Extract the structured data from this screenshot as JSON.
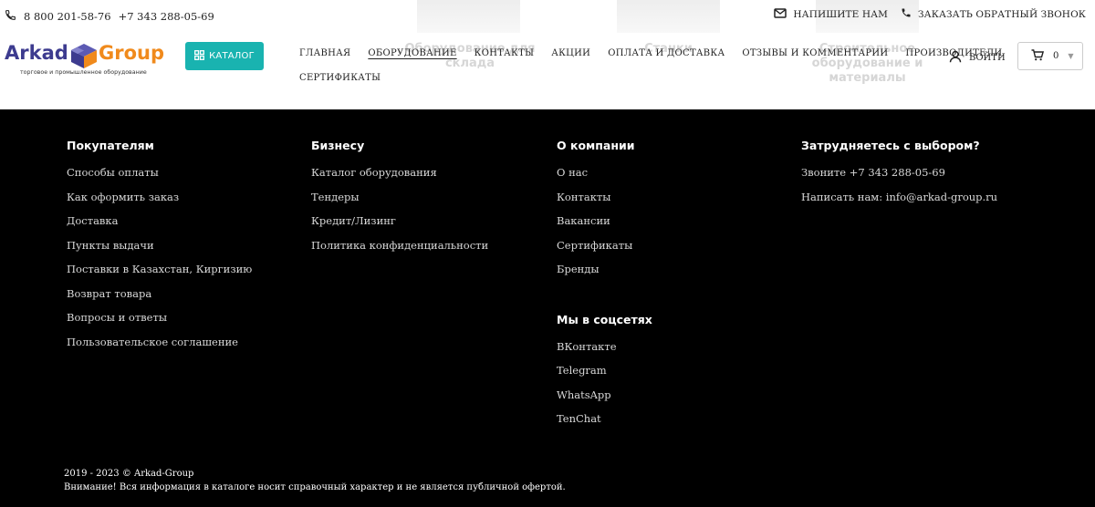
{
  "header": {
    "phones": [
      "8 800 201-58-76",
      "+7 343 288-05-69"
    ],
    "write_us": "НАПИШИТЕ НАМ",
    "callback": "ЗАКАЗАТЬ ОБРАТНЫЙ ЗВОНОК",
    "logo": {
      "word1": "Arkad",
      "word2": "Group",
      "tagline": "торговое и промышленное оборудование"
    },
    "catalog_button": "КАТАЛОГ",
    "nav": [
      {
        "label": "ГЛАВНАЯ"
      },
      {
        "label": "ОБОРУДОВАНИЕ"
      },
      {
        "label": "КОНТАКТЫ"
      },
      {
        "label": "АКЦИИ"
      },
      {
        "label": "ОПЛАТА И ДОСТАВКА"
      },
      {
        "label": "ОТЗЫВЫ И КОММЕНТАРИИ"
      },
      {
        "label": "ПРОИЗВОДИТЕЛИ"
      },
      {
        "label": "СЕРТИФИКАТЫ"
      }
    ],
    "active_nav": "ОБОРУДОВАНИЕ",
    "login": "ВОЙТИ",
    "cart_count": "0",
    "background_captions": [
      "Оборудование для склада",
      "Станки",
      "Строительное оборудование и материалы"
    ]
  },
  "footer": {
    "columns": [
      {
        "title": "Покупателям",
        "links": [
          "Способы оплаты",
          "Как оформить заказ",
          "Доставка",
          "Пункты выдачи",
          "Поставки в Казахстан, Киргизию",
          "Возврат товара",
          "Вопросы и ответы",
          "Пользовательское соглашение"
        ]
      },
      {
        "title": "Бизнесу",
        "links": [
          "Каталог оборудования",
          "Тендеры",
          "Кредит/Лизинг",
          "Политика конфиденциальности"
        ]
      },
      {
        "title": "О компании",
        "links": [
          "О нас",
          "Контакты",
          "Вакансии",
          "Сертификаты",
          "Бренды"
        ]
      },
      {
        "title": "Затрудняетесь с выбором?",
        "links": [
          "Звоните +7 343 288-05-69",
          "Написать нам: info@arkad-group.ru"
        ]
      }
    ],
    "social": {
      "title": "Мы в соцсетях",
      "links": [
        "ВКонтакте",
        "Telegram",
        "WhatsApp",
        "TenChat"
      ]
    },
    "copyright": "2019 - 2023 © Arkad-Group",
    "disclaimer": "Внимание! Вся информация в каталоге носит справочный характер и не является публичной офертой."
  },
  "colors": {
    "accent": "#19b3b0",
    "logo_primary": "#3d3b8f",
    "logo_secondary": "#f08a1c",
    "footer_bg": "#000000"
  },
  "icons": [
    "phone-icon",
    "mail-icon",
    "phone-callback-icon",
    "grid-icon",
    "user-icon",
    "cart-icon",
    "chevron-down-icon"
  ]
}
